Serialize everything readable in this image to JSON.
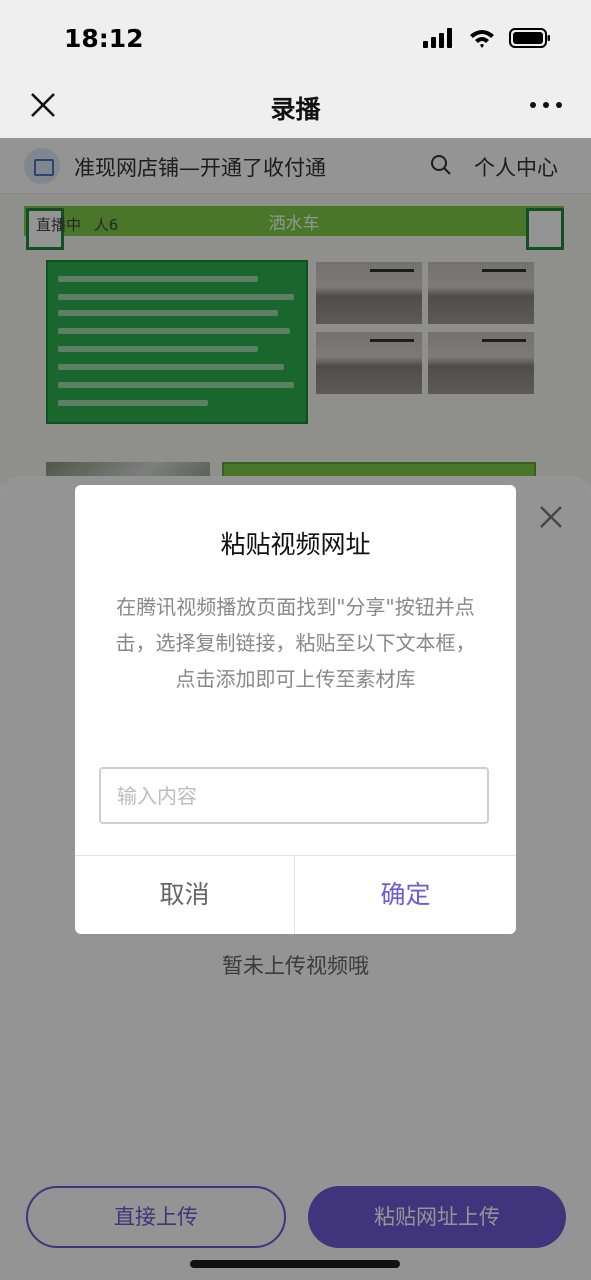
{
  "status_bar": {
    "time": "18:12"
  },
  "nav": {
    "title": "录播"
  },
  "webpage": {
    "store_name": "准现网店铺—开通了收付通",
    "personal_center": "个人中心",
    "live_label": "直播中",
    "live_viewers": "人6",
    "banner_title": "洒水车"
  },
  "sheet": {
    "empty_text": "暂未上传视频哦",
    "direct_upload_label": "直接上传",
    "paste_upload_label": "粘贴网址上传"
  },
  "dialog": {
    "title": "粘贴视频网址",
    "description": "在腾讯视频播放页面找到\"分享\"按钮并点击，选择复制链接，粘贴至以下文本框，点击添加即可上传至素材库",
    "input_placeholder": "输入内容",
    "input_value": "",
    "cancel_label": "取消",
    "confirm_label": "确定"
  },
  "colors": {
    "accent": "#6e5bd6",
    "banner_green": "#7fcb45",
    "panel_green": "#2eb24f"
  }
}
